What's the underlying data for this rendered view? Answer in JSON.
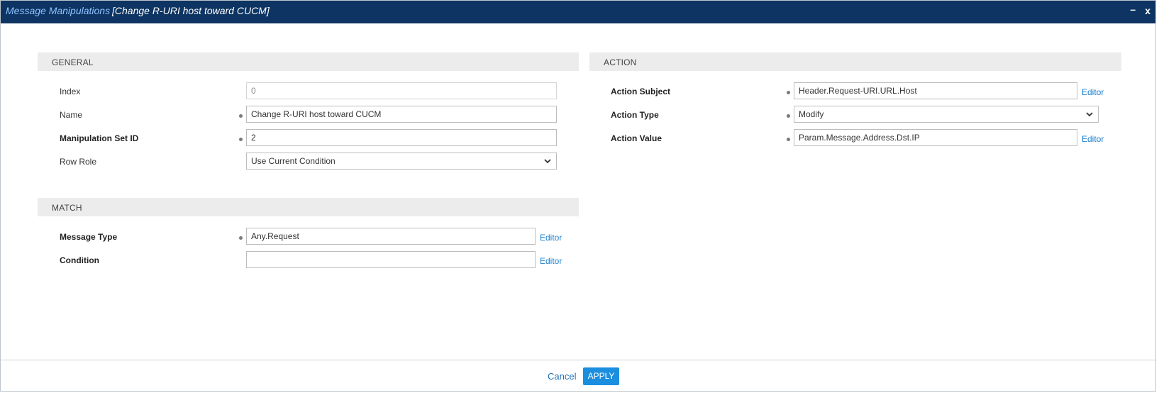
{
  "titlebar": {
    "module": "Message Manipulations",
    "record": "[Change R-URI host toward CUCM]",
    "minimize_label": "–",
    "close_label": "x"
  },
  "general": {
    "header": "GENERAL",
    "index": {
      "label": "Index",
      "value": "0"
    },
    "name": {
      "label": "Name",
      "value": "Change R-URI host toward CUCM"
    },
    "manipulation_set_id": {
      "label": "Manipulation Set ID",
      "value": "2"
    },
    "row_role": {
      "label": "Row Role",
      "value": "Use Current Condition"
    }
  },
  "match": {
    "header": "MATCH",
    "message_type": {
      "label": "Message Type",
      "value": "Any.Request",
      "editor": "Editor"
    },
    "condition": {
      "label": "Condition",
      "value": "",
      "editor": "Editor"
    }
  },
  "action": {
    "header": "ACTION",
    "subject": {
      "label": "Action Subject",
      "value": "Header.Request-URI.URL.Host",
      "editor": "Editor"
    },
    "type": {
      "label": "Action Type",
      "value": "Modify"
    },
    "value": {
      "label": "Action Value",
      "value": "Param.Message.Address.Dst.IP",
      "editor": "Editor"
    }
  },
  "footer": {
    "cancel_label": "Cancel",
    "apply_label": "APPLY"
  },
  "colors": {
    "titlebar_bg": "#0d3462",
    "accent": "#1b8ee0",
    "link": "#1d82d1"
  }
}
